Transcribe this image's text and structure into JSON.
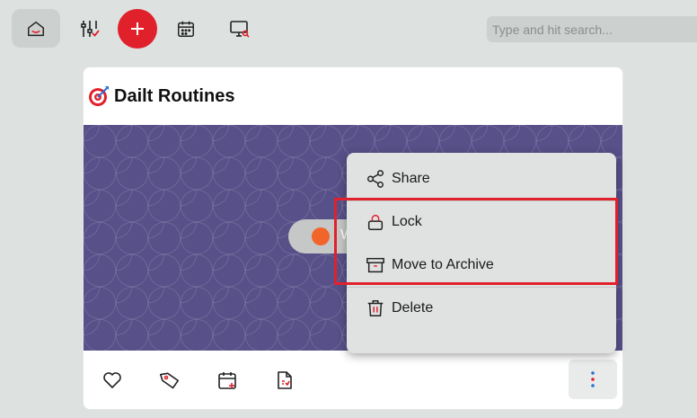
{
  "toolbar": {
    "icons": [
      "home-icon",
      "filter-sliders-icon",
      "plus-icon",
      "calendar-icon",
      "monitor-search-icon"
    ],
    "search_placeholder": "Type and hit search..."
  },
  "card": {
    "title_icon": "target-dart-icon",
    "title": "Dailt Routines",
    "banner_pill_text": "W",
    "actions": [
      "heart-icon",
      "tag-icon",
      "calendar-plus-icon",
      "document-icon",
      "more-vertical-icon"
    ]
  },
  "menu": {
    "items": [
      {
        "label": "Share",
        "icon": "share-icon"
      },
      {
        "label": "Lock",
        "icon": "lock-icon"
      },
      {
        "label": "Move to Archive",
        "icon": "archive-icon"
      },
      {
        "label": "Delete",
        "icon": "trash-icon"
      }
    ]
  },
  "colors": {
    "accent_red": "#e0212b",
    "banner": "#575089",
    "pill_dot": "#f2652a",
    "background": "#dde1e0"
  }
}
